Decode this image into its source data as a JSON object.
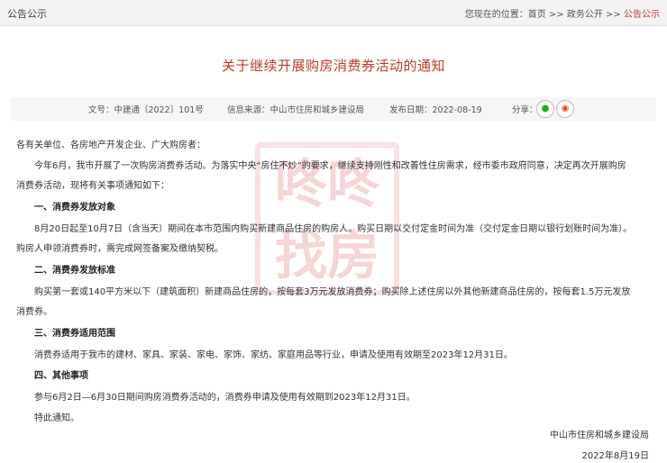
{
  "header": {
    "section": "公告公示",
    "location_label": "您现在的位置：",
    "crumbs": [
      "首页",
      "政务公开",
      "公告公示"
    ],
    "sep": " >> "
  },
  "article": {
    "title": "关于继续开展购房消费券活动的通知",
    "meta": {
      "doc_no": "文号：中建通〔2022〕101号",
      "source": "信息来源：中山市住房和城乡建设局",
      "date": "发布日期：2022-08-19",
      "share_label": "分享："
    },
    "watermark": "咚咚找房",
    "body": {
      "greeting": "各有关单位、各房地产开发企业、广大购房者：",
      "intro_1": "今年6月，我市开展了一次购房消费券活动。为落实中央“房住不炒”的要求，继续支持刚性和改善性住房需求，经市委市政府同意，决定再次开展购房",
      "intro_2": "消费券活动，现将有关事项通知如下：",
      "s1_title": "一、消费券发放对象",
      "s1_l1": "8月20日起至10月7日（含当天）期间在本市范围内购买新建商品住房的购房人。购买日期以交付定金时间为准（交付定金日期以银行划账时间为准）。",
      "s1_l2": "购房人申领消费券时，需完成网签备案及缴纳契税。",
      "s2_title": "二、消费券发放标准",
      "s2_l1": "购买第一套或140平方米以下（建筑面积）新建商品住房的，按每套3万元发放消费券；购买除上述住房以外其他新建商品住房的，按每套1.5万元发放",
      "s2_l2": "消费券。",
      "s3_title": "三、消费券适用范围",
      "s3_l1": "消费券适用于我市的建材、家具、家装、家电、家饰、家纺、家庭用品等行业，申请及使用有效期至2023年12月31日。",
      "s4_title": "四、其他事项",
      "s4_l1": "参与6月2日—6月30日期间购房消费券活动的，消费券申请及使用有效期到2023年12月31日。",
      "closing": "特此通知。"
    },
    "signature": {
      "org": "中山市住房和城乡建设局",
      "date": "2022年8月19日"
    }
  }
}
